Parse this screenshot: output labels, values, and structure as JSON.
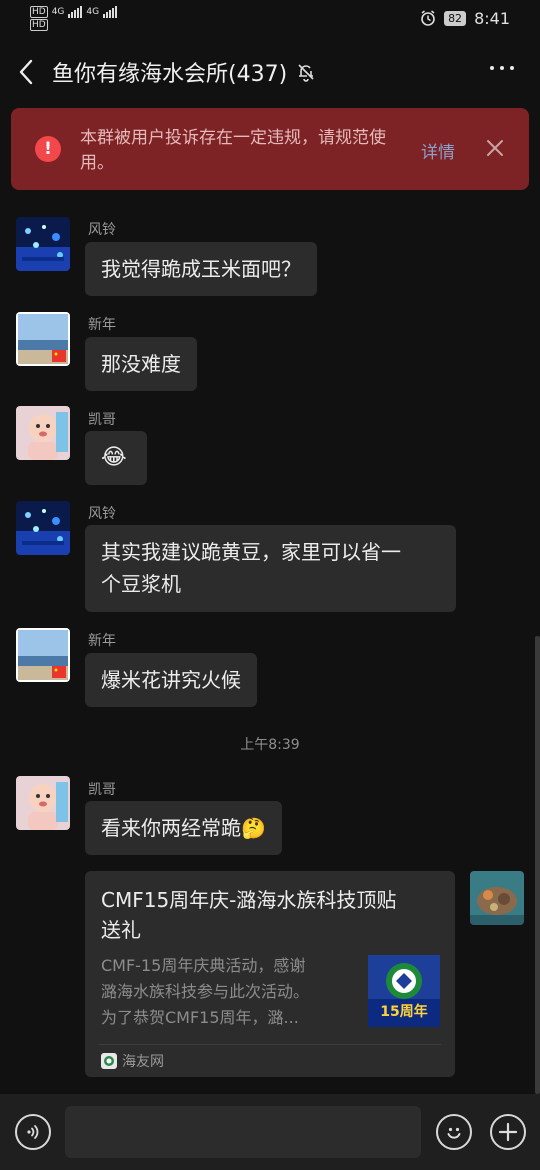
{
  "status_bar": {
    "sim1": "HD",
    "sim2": "HD",
    "net1": "4G",
    "net2": "4G",
    "battery": "82",
    "time": "8:41"
  },
  "header": {
    "title": "鱼你有缘海水会所(437)"
  },
  "warning": {
    "text": "本群被用户投诉存在一定违规，请规范使用。",
    "details_label": "详情"
  },
  "messages": [
    {
      "sender": "风铃",
      "text": "我觉得跪成玉米面吧？"
    },
    {
      "sender": "新年",
      "text": "那没难度"
    },
    {
      "sender": "凯哥",
      "text": "😂"
    },
    {
      "sender": "风铃",
      "text_line1": "其实我建议跪黄豆，家里可以省一",
      "text_line2": "个豆浆机"
    },
    {
      "sender": "新年",
      "text": "爆米花讲究火候"
    },
    {
      "sender": "凯哥",
      "text": "看来你两经常跪🤔"
    }
  ],
  "timestamp": "上午8:39",
  "link_card": {
    "title_line1": "CMF15周年庆-潞海水族科技顶贴",
    "title_line2": "送礼",
    "desc_line1": "CMF-15周年庆典活动，感谢",
    "desc_line2": "潞海水族科技参与此次活动。",
    "desc_line3": "为了恭贺CMF15周年，潞...",
    "thumb_text": "15周年",
    "source": "海友网"
  },
  "colors": {
    "background": "#111111",
    "bubble": "#2c2c2c",
    "warning_bg": "#7d2225",
    "warning_icon": "#f2474b",
    "link": "#8ba0cc"
  }
}
